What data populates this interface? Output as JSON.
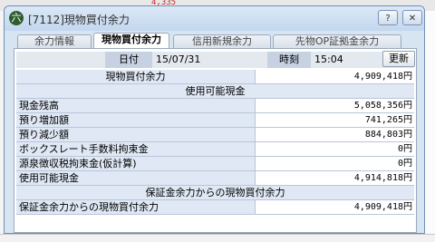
{
  "background": {
    "partial_red_number": "4,335"
  },
  "window": {
    "title": "[7112]現物買付余力",
    "help_label": "?",
    "close_label": "✕",
    "app_icon_glyph": "六"
  },
  "tabs": [
    {
      "label": "余力情報",
      "active": false
    },
    {
      "label": "現物買付余力",
      "active": true
    },
    {
      "label": "信用新規余力",
      "active": false
    },
    {
      "label": "先物OP証拠金余力",
      "active": false
    }
  ],
  "header": {
    "date_label": "日付",
    "date_value": "15/07/31",
    "time_label": "時刻",
    "time_value": "15:04",
    "refresh_label": "更新"
  },
  "rows": [
    {
      "label": "現物買付余力",
      "value": "4,909,418円",
      "center": true
    },
    {
      "section": "使用可能現金"
    },
    {
      "label": "現金残高",
      "value": "5,058,356円"
    },
    {
      "label": "預り増加額",
      "value": "741,265円"
    },
    {
      "label": "預り減少額",
      "value": "884,803円"
    },
    {
      "label": "ボックスレート手数料拘束金",
      "value": "0円"
    },
    {
      "label": "源泉徴収税拘束金(仮計算)",
      "value": "0円"
    },
    {
      "label": "使用可能現金",
      "value": "4,914,818円"
    },
    {
      "section": "保証金余力からの現物買付余力"
    },
    {
      "label": "保証金余力からの現物買付余力",
      "value": "4,909,418円"
    }
  ],
  "colors": {
    "title_bg": "#c3d7ee",
    "label_cell_bg": "#dfe8f4",
    "background_number": "#d02020"
  }
}
